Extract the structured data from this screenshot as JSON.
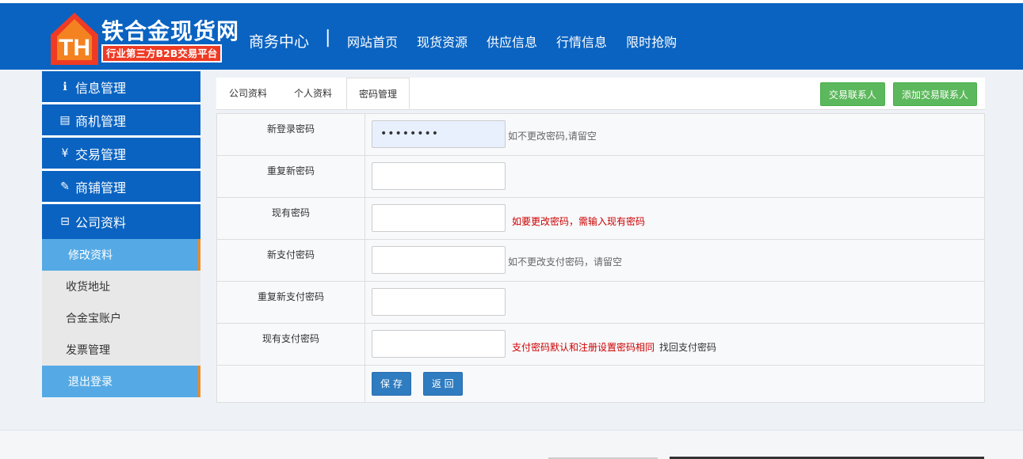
{
  "header": {
    "logo_title": "铁合金现货网",
    "logo_subtitle": "行业第三方B2B交易平台",
    "logo_letters": "TH",
    "center_title": "商务中心",
    "separator": "|",
    "nav": [
      "网站首页",
      "现货资源",
      "供应信息",
      "行情信息",
      "限时抢购"
    ]
  },
  "sidebar": {
    "main_items": [
      {
        "label": "信息管理",
        "icon": "info-circle-icon",
        "glyph": "ℹ"
      },
      {
        "label": "商机管理",
        "icon": "list-icon",
        "glyph": "▤"
      },
      {
        "label": "交易管理",
        "icon": "yen-icon",
        "glyph": "¥"
      },
      {
        "label": "商铺管理",
        "icon": "pencil-icon",
        "glyph": "✎"
      },
      {
        "label": "公司资料",
        "icon": "inbox-icon",
        "glyph": "⊟"
      }
    ],
    "sub_items": [
      "修改资料",
      "收货地址",
      "合金宝账户",
      "发票管理",
      "退出登录"
    ]
  },
  "tabs": [
    "公司资料",
    "个人资料",
    "密码管理"
  ],
  "actions": {
    "trade_contact": "交易联系人",
    "add_trade_contact": "添加交易联系人"
  },
  "form": {
    "rows": [
      {
        "label": "新登录密码",
        "value": "••••••••",
        "hint": "如不更改密码,请留空"
      },
      {
        "label": "重复新密码",
        "value": "",
        "hint": ""
      },
      {
        "label": "现有密码",
        "value": "",
        "hint": "如要更改密码，需输入现有密码"
      },
      {
        "label": "新支付密码",
        "value": "",
        "hint": "如不更改支付密码，请留空"
      },
      {
        "label": "重复新支付密码",
        "value": "",
        "hint": ""
      },
      {
        "label": "现有支付密码",
        "value": "",
        "hint": "支付密码默认和注册设置密码相同",
        "link": "找回支付密码"
      }
    ],
    "save": "保 存",
    "back": "返 回"
  },
  "colors": {
    "header": "#0a63c1",
    "accent_orange": "#f08a24",
    "logo_red": "#ef3b24",
    "green": "#5cb85c",
    "blue_btn": "#2f7cc0",
    "hint_red": "#cc0000"
  }
}
